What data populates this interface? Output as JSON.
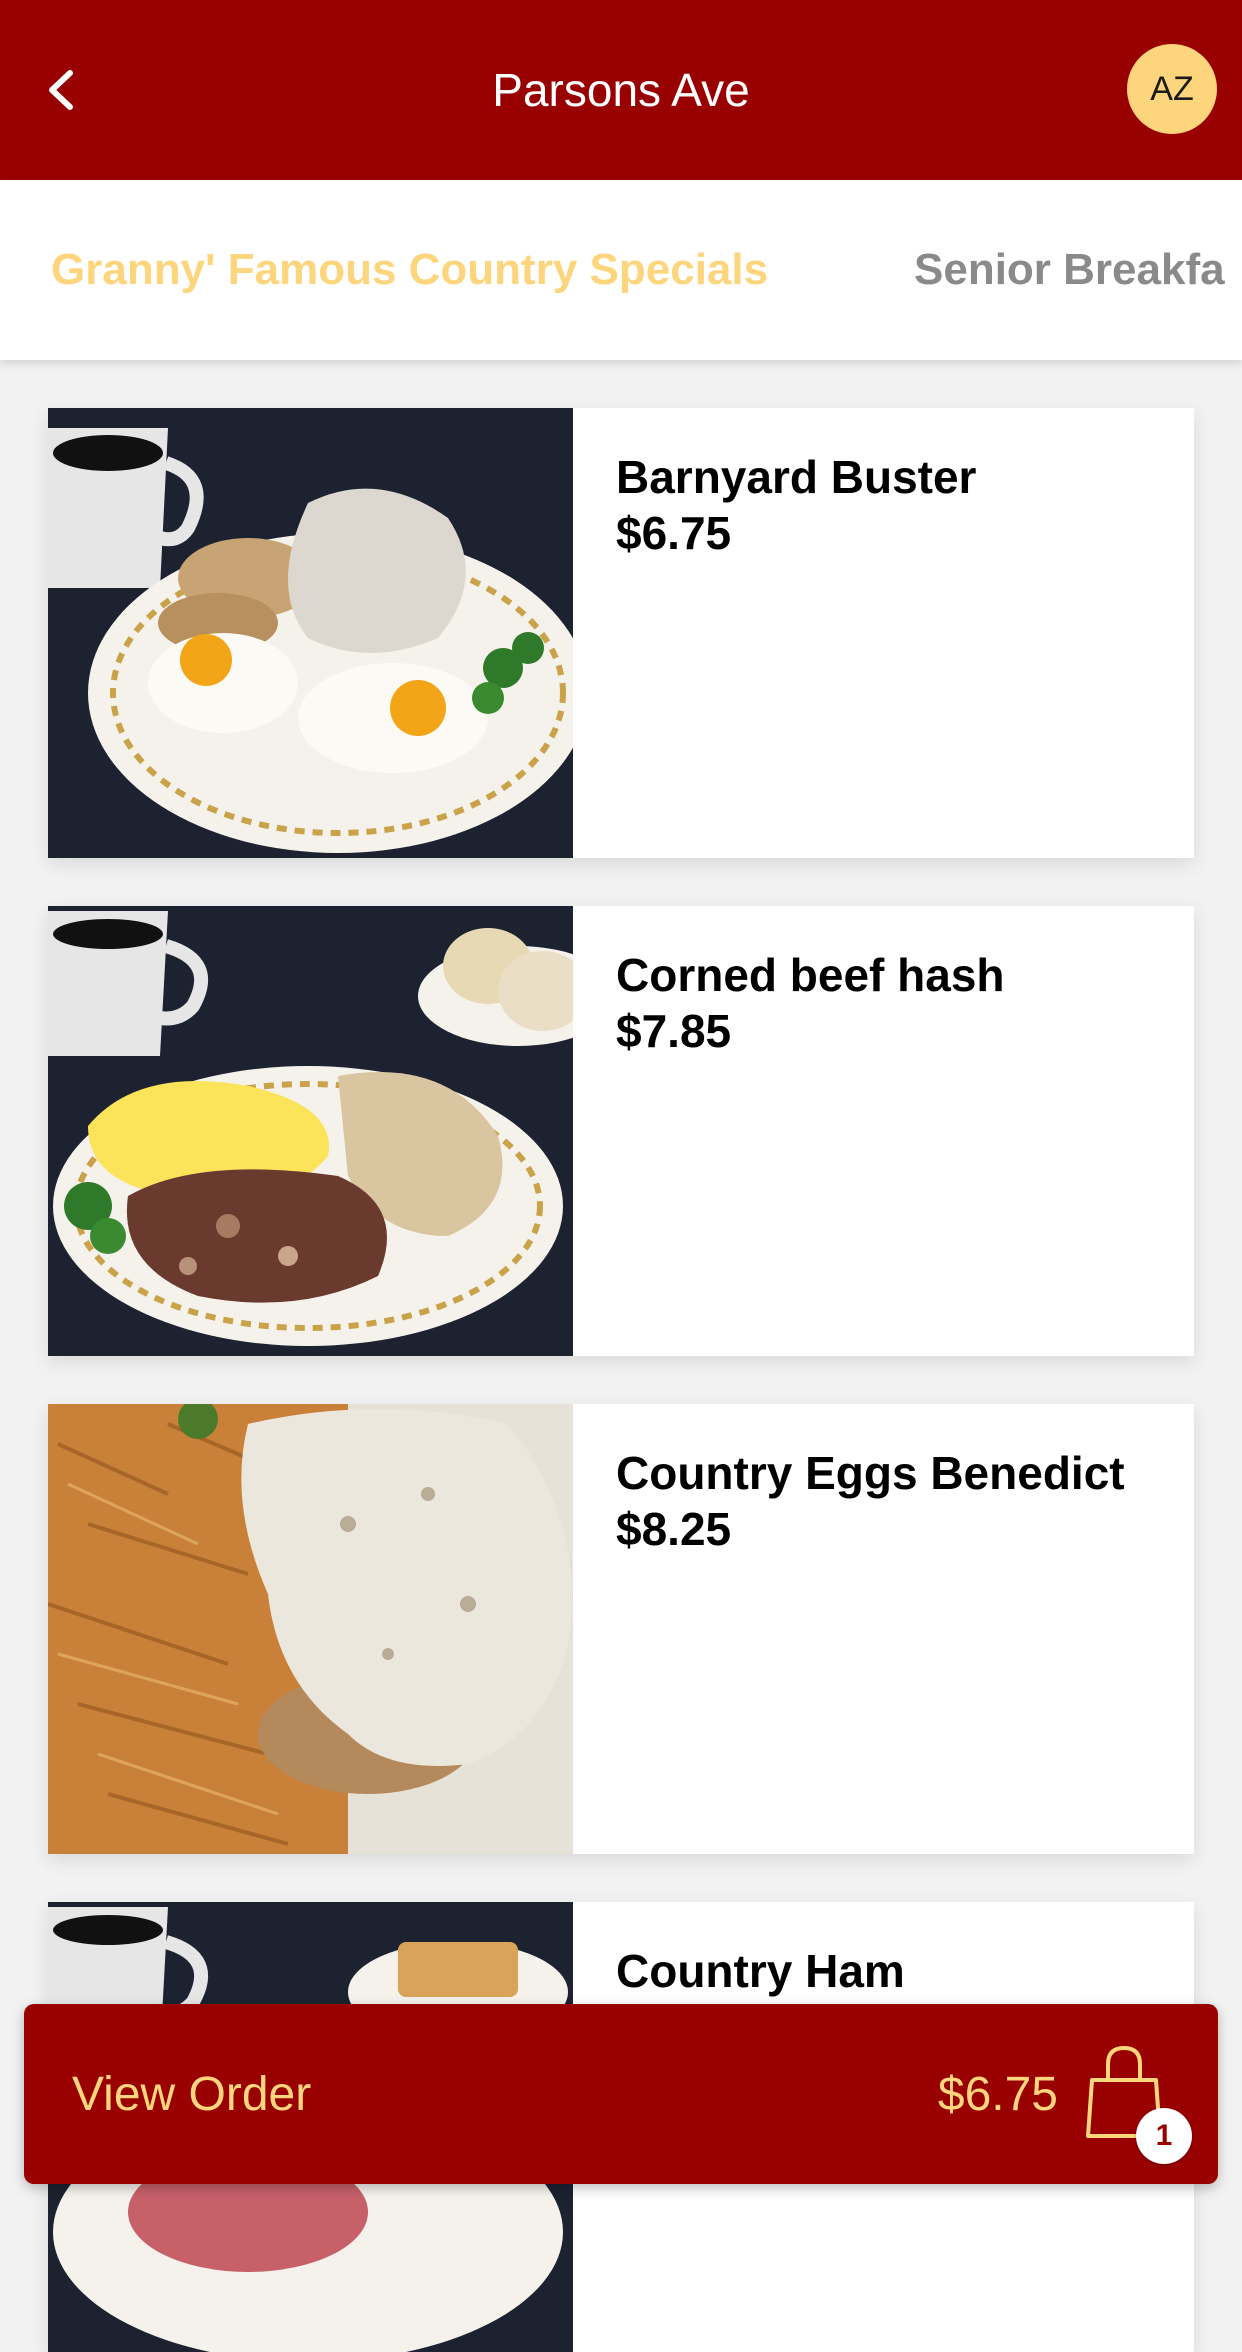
{
  "header": {
    "title": "Parsons Ave",
    "avatar_initials": "AZ",
    "back_icon": "chevron-left-icon",
    "colors": {
      "bar": "#990000",
      "avatar": "#fdd57d"
    }
  },
  "tabs": [
    {
      "label": "Granny' Famous Country Specials",
      "active": true
    },
    {
      "label": "Senior Breakfa",
      "active": false
    }
  ],
  "menu_items": [
    {
      "name": "Barnyard Buster",
      "price": "$6.75"
    },
    {
      "name": "Corned beef hash",
      "price": "$7.85"
    },
    {
      "name": "Country Eggs Benedict",
      "price": "$8.25"
    },
    {
      "name": "Country Ham",
      "price": ""
    }
  ],
  "order_bar": {
    "label": "View Order",
    "total": "$6.75",
    "item_count": "1",
    "bag_icon": "shopping-bag-icon",
    "accent_color": "#fdd57d"
  }
}
